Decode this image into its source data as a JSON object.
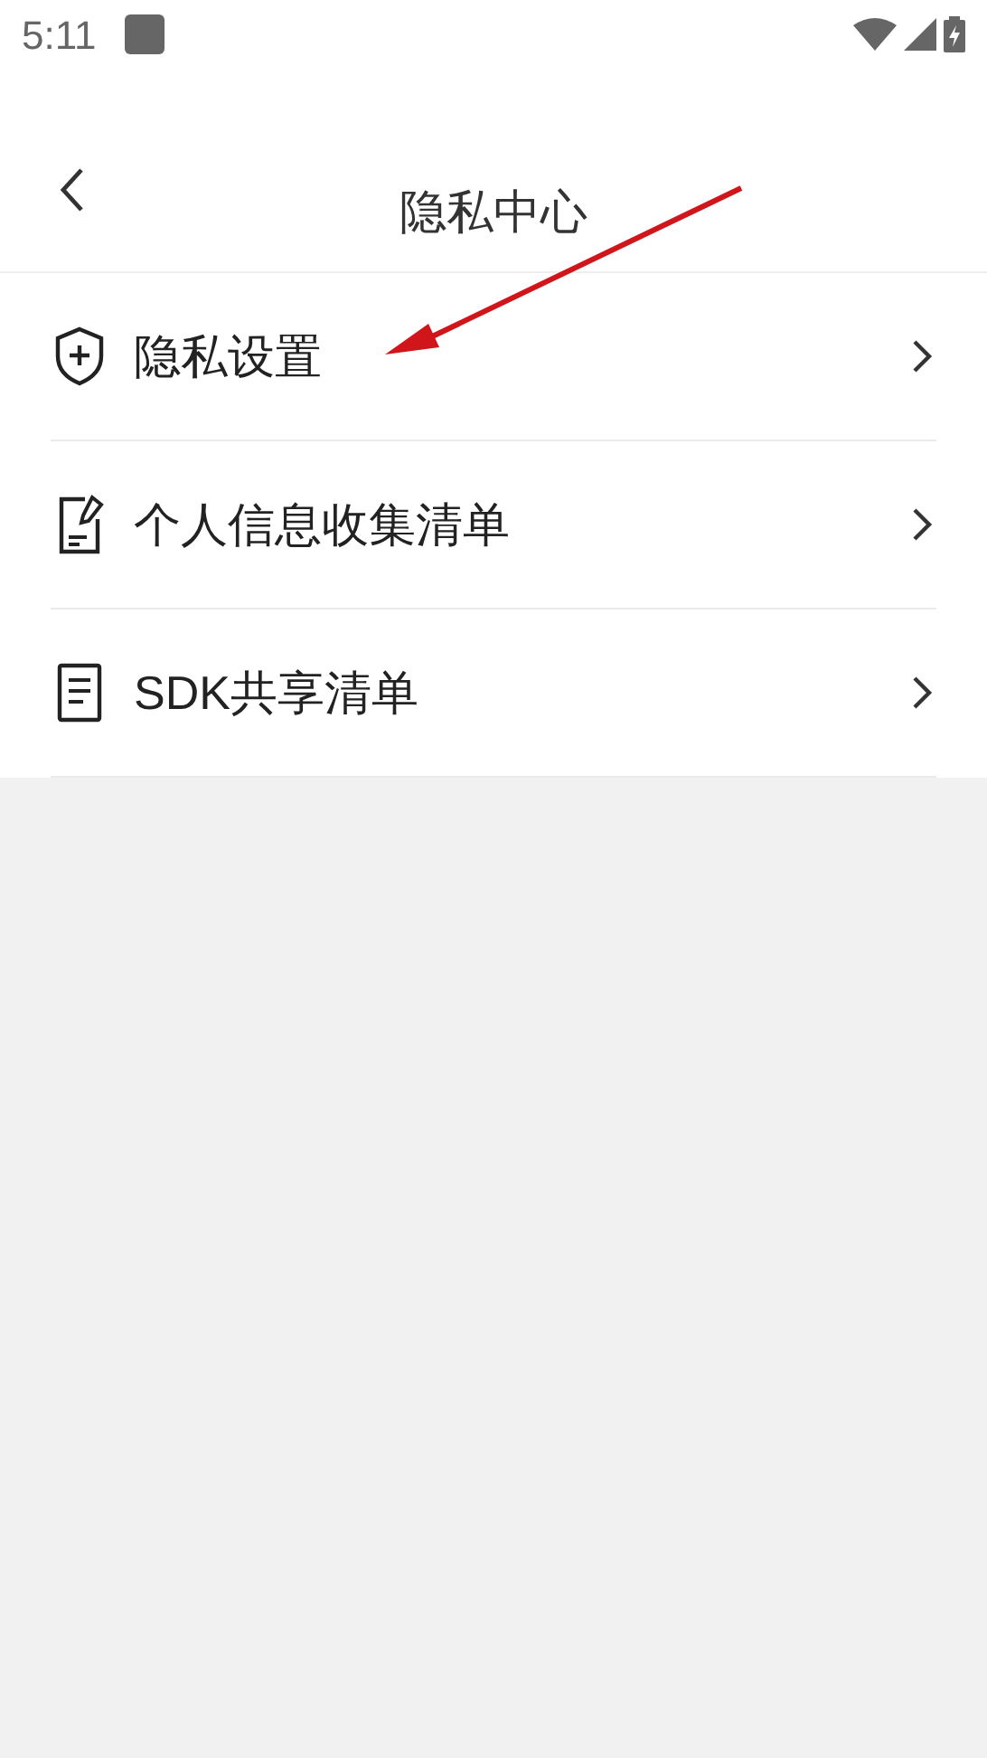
{
  "status_bar": {
    "time": "5:11"
  },
  "header": {
    "title": "隐私中心"
  },
  "menu_items": [
    {
      "kind": "shield",
      "label": "隐私设置"
    },
    {
      "kind": "document-edit",
      "label": "个人信息收集清单"
    },
    {
      "kind": "document",
      "label": "SDK共享清单"
    }
  ],
  "annotation": {
    "kind": "arrow"
  }
}
